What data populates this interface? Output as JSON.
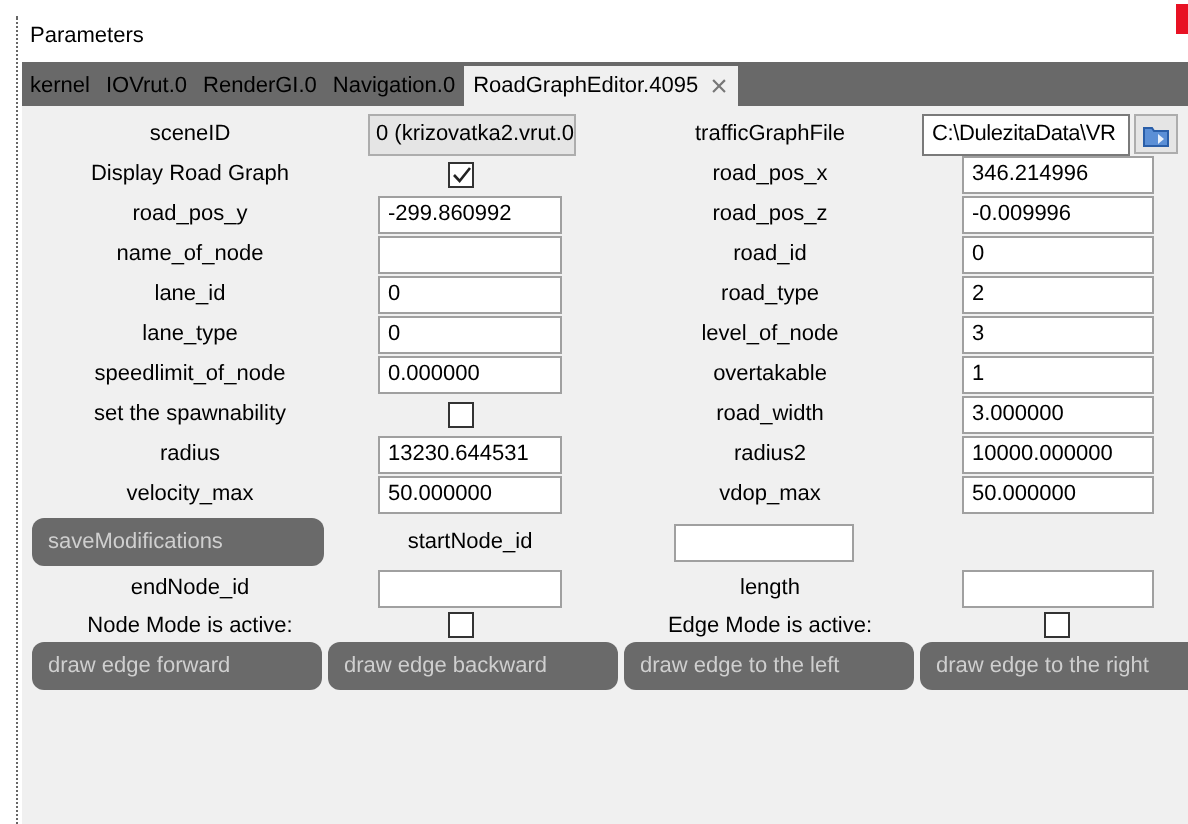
{
  "window": {
    "title": "Parameters"
  },
  "tabs": [
    {
      "label": "kernel",
      "selected": false
    },
    {
      "label": "IOVrut.0",
      "selected": false
    },
    {
      "label": "RenderGI.0",
      "selected": false
    },
    {
      "label": "Navigation.0",
      "selected": false
    },
    {
      "label": "RoadGraphEditor.4095",
      "selected": true,
      "close": "×"
    }
  ],
  "rows": [
    {
      "left": {
        "label": "sceneID",
        "kind": "dropdown",
        "value": "0 (krizovatka2.vrut.0"
      },
      "right": {
        "label": "trafficGraphFile",
        "kind": "file",
        "value": "C:\\DulezitaData\\VR"
      }
    },
    {
      "left": {
        "label": "Display Road Graph",
        "kind": "checkbox",
        "checked": true
      },
      "right": {
        "label": "road_pos_x",
        "kind": "field",
        "value": "346.214996"
      }
    },
    {
      "left": {
        "label": "road_pos_y",
        "kind": "field",
        "value": "-299.860992"
      },
      "right": {
        "label": "road_pos_z",
        "kind": "field",
        "value": "-0.009996"
      }
    },
    {
      "left": {
        "label": "name_of_node",
        "kind": "field"
      },
      "right": {
        "label": "road_id",
        "kind": "field",
        "value": "0"
      }
    },
    {
      "left": {
        "label": "lane_id",
        "kind": "field",
        "value": "0"
      },
      "right": {
        "label": "road_type",
        "kind": "field",
        "value": "2"
      }
    },
    {
      "left": {
        "label": "lane_type",
        "kind": "field",
        "value": "0"
      },
      "right": {
        "label": "level_of_node",
        "kind": "field",
        "value": "3"
      }
    },
    {
      "left": {
        "label": "speedlimit_of_node",
        "kind": "field",
        "value": "0.000000"
      },
      "right": {
        "label": "overtakable",
        "kind": "field",
        "value": "1"
      }
    },
    {
      "left": {
        "label": "set the spawnability",
        "kind": "checkbox",
        "checked": false
      },
      "right": {
        "label": "road_width",
        "kind": "field",
        "value": "3.000000"
      }
    },
    {
      "left": {
        "label": "radius",
        "kind": "field",
        "value": "13230.644531"
      },
      "right": {
        "label": "radius2",
        "kind": "field",
        "value": "10000.000000"
      }
    },
    {
      "left": {
        "label": "velocity_max",
        "kind": "field",
        "value": "50.000000"
      },
      "right": {
        "label": "vdop_max",
        "kind": "field",
        "value": "50.000000"
      }
    }
  ],
  "save_row": {
    "button": "saveModifications",
    "label": "startNode_id"
  },
  "lower_rows": [
    {
      "left": {
        "label": "endNode_id",
        "kind": "field"
      },
      "right": {
        "label": "length",
        "kind": "field"
      }
    },
    {
      "left": {
        "label": "Node Mode is active:",
        "kind": "checkbox",
        "checked": false
      },
      "right": {
        "label": "Edge Mode is active:",
        "kind": "checkbox",
        "checked": false
      }
    }
  ],
  "buttons": [
    "draw edge forward",
    "draw edge backward",
    "draw edge to the left",
    "draw edge to the right"
  ]
}
